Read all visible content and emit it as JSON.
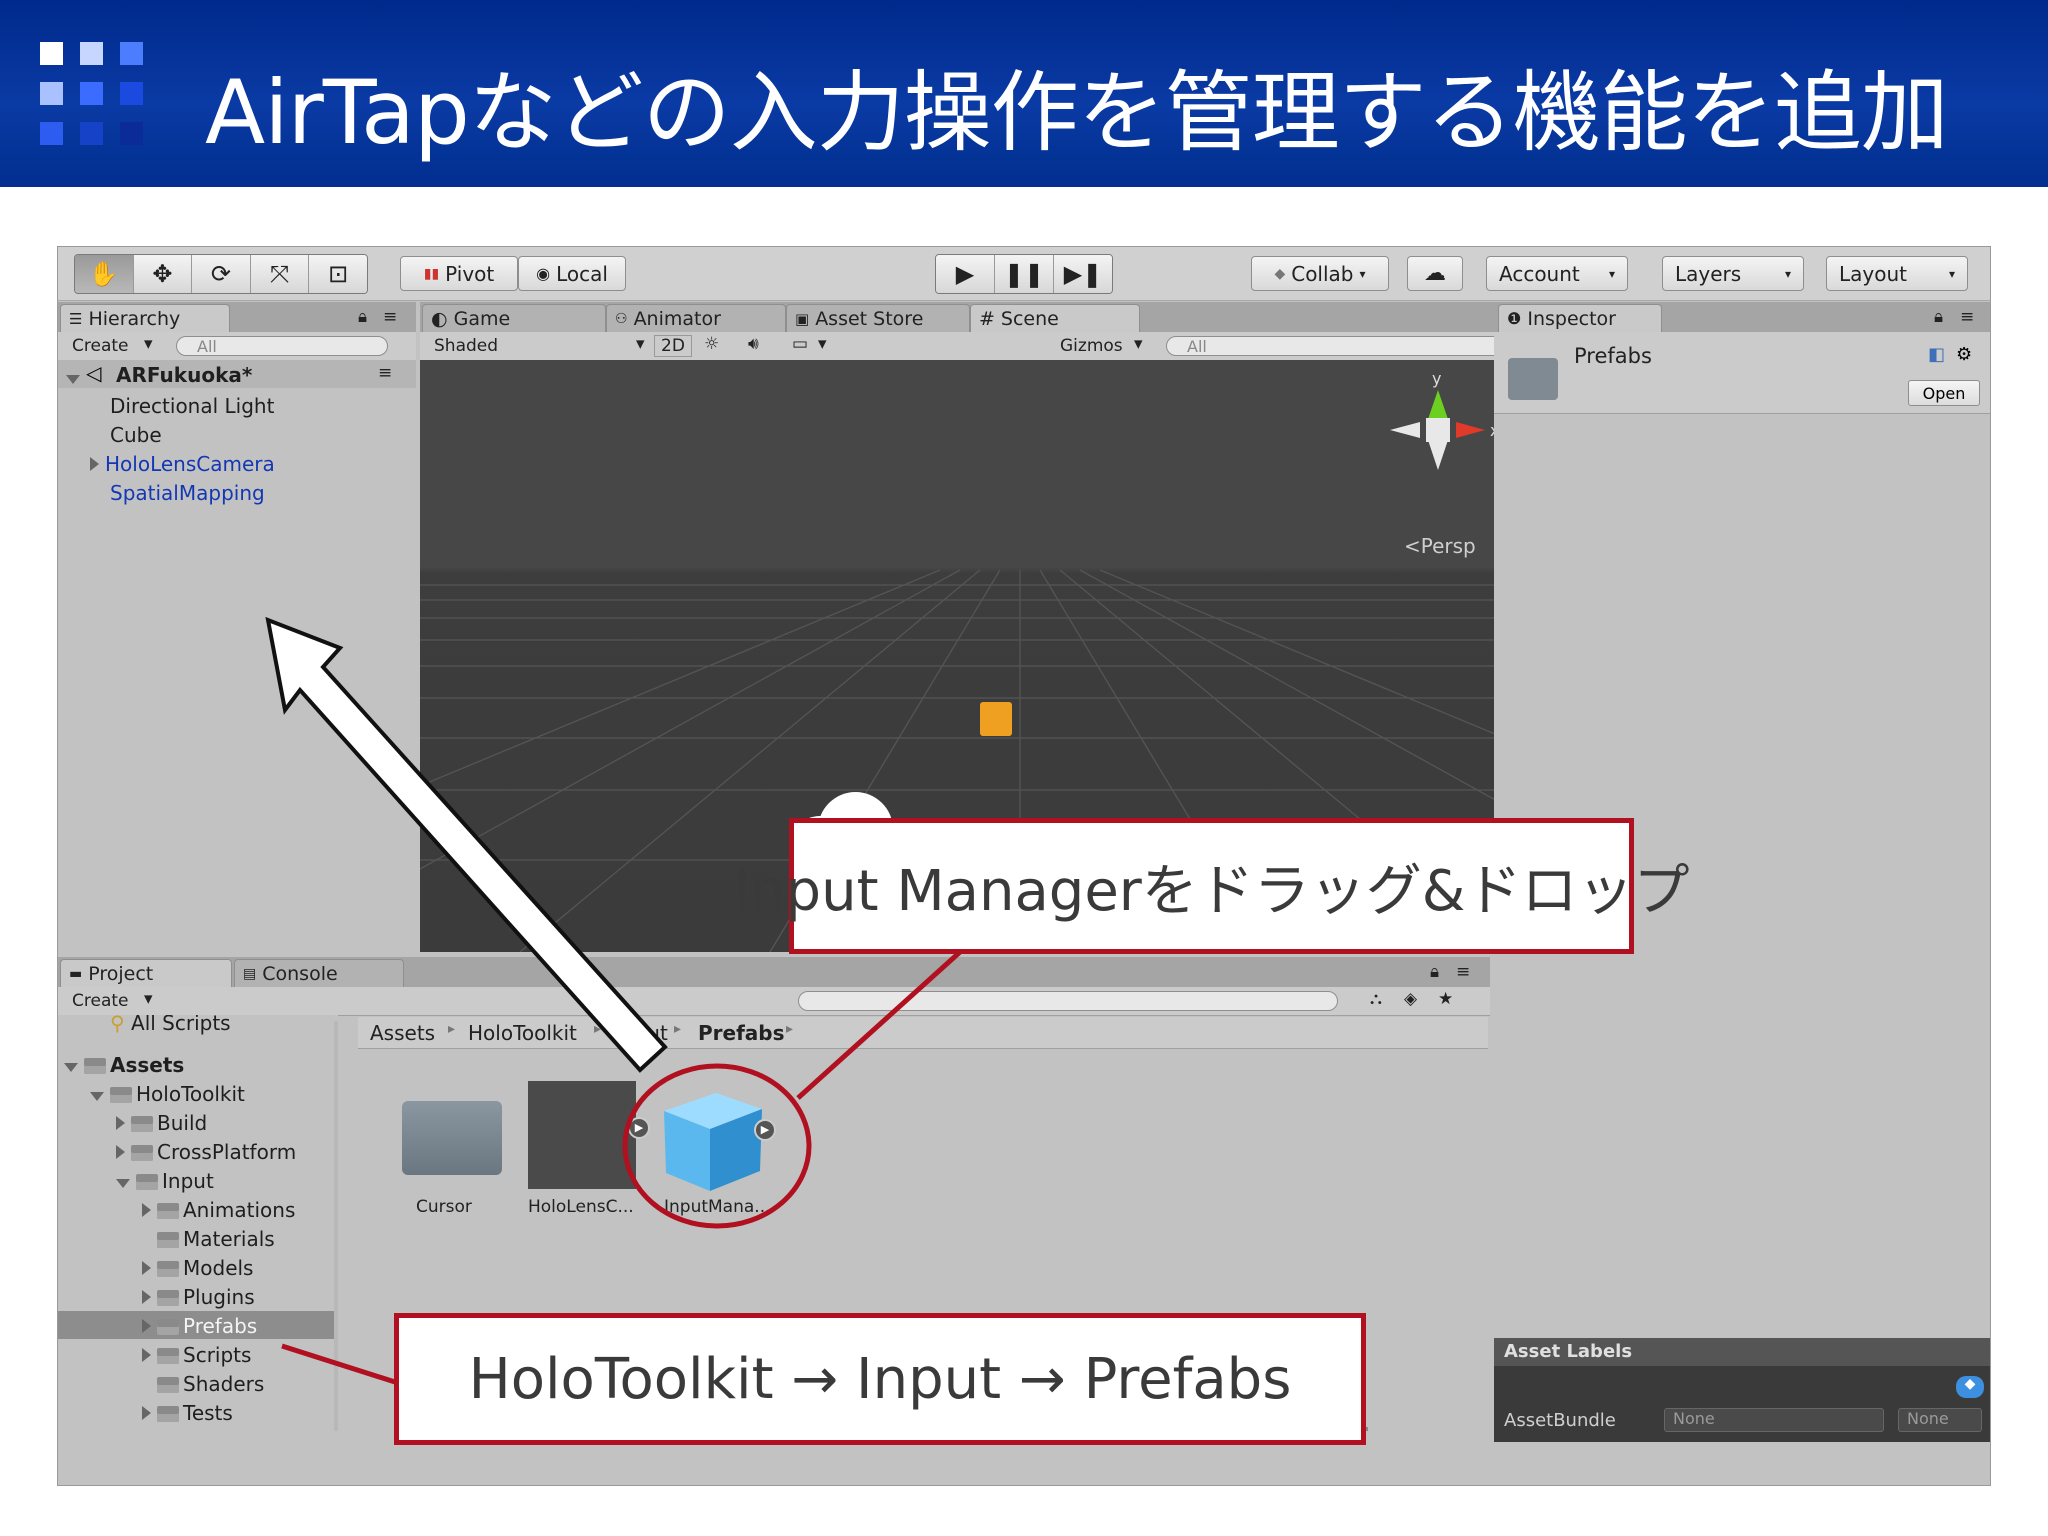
{
  "slide": {
    "title": "AirTapなどの入力操作を管理する機能を追加",
    "logo_colors": [
      "#ffffff",
      "#7fa6ff",
      "#2f6bff",
      "#1448d8",
      "#0a2fa8"
    ]
  },
  "toolbar": {
    "tools": [
      "hand-icon",
      "move-icon",
      "rotate-icon",
      "scale-icon",
      "rect-tool-icon"
    ],
    "pivot_label": "Pivot",
    "local_label": "Local",
    "play_controls": [
      "play-icon",
      "pause-icon",
      "step-icon"
    ],
    "collab_label": "Collab",
    "account_label": "Account",
    "layers_label": "Layers",
    "layout_label": "Layout"
  },
  "hierarchy": {
    "tab_label": "Hierarchy",
    "create_label": "Create",
    "search_placeholder": "All",
    "scene_name": "ARFukuoka*",
    "items": [
      "Directional Light",
      "Cube",
      "HoloLensCamera",
      "SpatialMapping"
    ]
  },
  "scene_tabs": {
    "game": "Game",
    "animator": "Animator",
    "asset_store": "Asset Store",
    "scene": "Scene",
    "shading_mode": "Shaded",
    "mode_2d": "2D",
    "gizmos_label": "Gizmos",
    "search_placeholder": "All",
    "gizmo_y": "y",
    "gizmo_x": "x",
    "persp_label": "Persp"
  },
  "inspector": {
    "tab_label": "Inspector",
    "asset_name": "Prefabs",
    "open_button": "Open",
    "asset_labels_header": "Asset Labels",
    "assetbundle_label": "AssetBundle",
    "assetbundle_value": "None",
    "assetbundle_variant": "None"
  },
  "project": {
    "tab_label": "Project",
    "console_tab": "Console",
    "create_label": "Create",
    "breadcrumb": [
      "Assets",
      "HoloToolkit",
      "Input",
      "Prefabs"
    ],
    "tree": {
      "all_scripts": "All Scripts",
      "assets": "Assets",
      "holotoolkit": "HoloToolkit",
      "build": "Build",
      "crossplatform": "CrossPlatform",
      "input": "Input",
      "animations": "Animations",
      "materials": "Materials",
      "models": "Models",
      "plugins": "Plugins",
      "prefabs": "Prefabs",
      "scripts": "Scripts",
      "shaders": "Shaders",
      "tests": "Tests"
    },
    "grid_items": [
      "Cursor",
      "HoloLensC...",
      "InputMana..."
    ]
  },
  "callouts": {
    "input_manager": "Input Managerをドラッグ&ドロップ",
    "path": "HoloToolkit → Input → Prefabs"
  },
  "colors": {
    "header_blue": "#0a35a0",
    "callout_red": "#b0101f",
    "gizmo_y_green": "#6cd020",
    "gizmo_x_red": "#e03a2a",
    "cube_orange": "#f0a020",
    "prefab_blue": "#5ab8ee"
  }
}
